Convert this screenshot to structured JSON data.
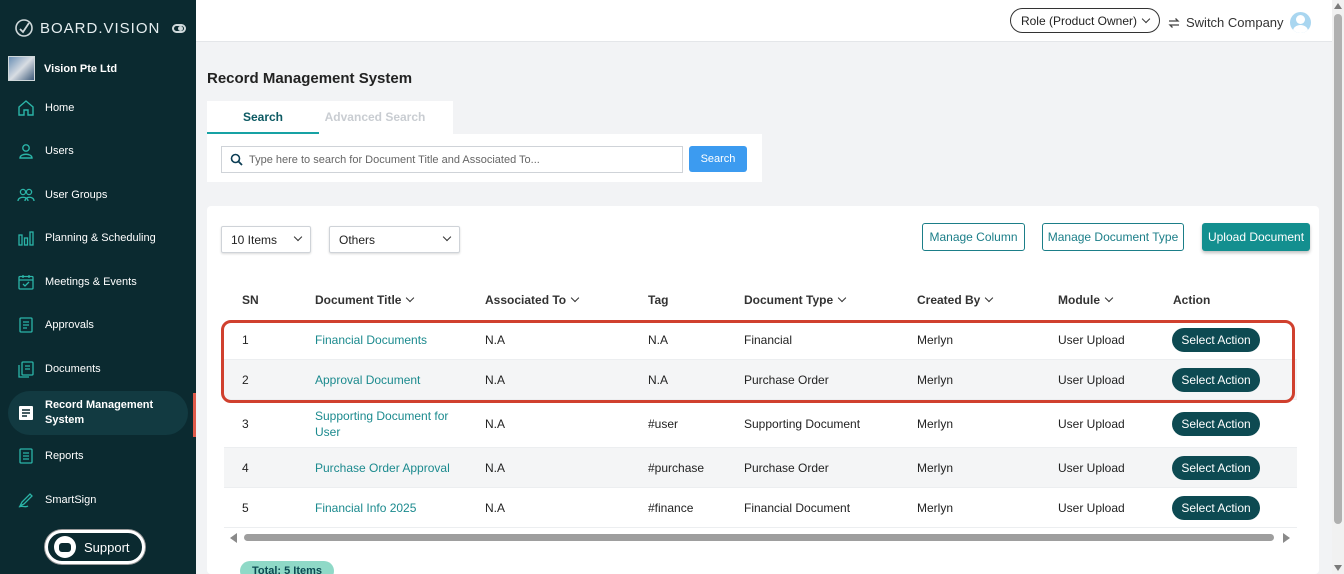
{
  "brand": {
    "name": "BOARD.VISION"
  },
  "company": {
    "name": "Vision Pte Ltd"
  },
  "sidebar": {
    "items": [
      {
        "label": "Home",
        "icon": "home-icon"
      },
      {
        "label": "Users",
        "icon": "user-icon"
      },
      {
        "label": "User Groups",
        "icon": "user-group-icon"
      },
      {
        "label": "Planning & Scheduling",
        "icon": "bar-chart-icon"
      },
      {
        "label": "Meetings & Events",
        "icon": "calendar-icon"
      },
      {
        "label": "Approvals",
        "icon": "approval-icon"
      },
      {
        "label": "Documents",
        "icon": "documents-icon"
      },
      {
        "label": "Record Management System",
        "icon": "record-icon",
        "active": true
      },
      {
        "label": "Reports",
        "icon": "reports-icon"
      },
      {
        "label": "SmartSign",
        "icon": "pen-icon"
      }
    ],
    "support_label": "Support"
  },
  "topbar": {
    "role": "Role (Product Owner)",
    "switch_company": "Switch Company"
  },
  "page": {
    "title": "Record Management System"
  },
  "tabs": [
    {
      "label": "Search",
      "active": true
    },
    {
      "label": "Advanced Search",
      "active": false
    }
  ],
  "search": {
    "placeholder": "Type here to search for Document Title and Associated To...",
    "button": "Search"
  },
  "controls": {
    "items_per_page": "10 Items",
    "filter": "Others",
    "manage_column": "Manage Column",
    "manage_document_type": "Manage Document Type",
    "upload_document": "Upload Document"
  },
  "table": {
    "columns": [
      "SN",
      "Document Title",
      "Associated To",
      "Tag",
      "Document Type",
      "Created By",
      "Module",
      "Action"
    ],
    "rows": [
      {
        "sn": "1",
        "title": "Financial Documents",
        "associated": "N.A",
        "tag": "N.A",
        "type": "Financial",
        "created_by": "Merlyn",
        "module": "User Upload",
        "action": "Select Action"
      },
      {
        "sn": "2",
        "title": "Approval Document",
        "associated": "N.A",
        "tag": "N.A",
        "type": "Purchase Order",
        "created_by": "Merlyn",
        "module": "User Upload",
        "action": "Select Action"
      },
      {
        "sn": "3",
        "title": "Supporting Document for User",
        "associated": "N.A",
        "tag": "#user",
        "type": "Supporting Document",
        "created_by": "Merlyn",
        "module": "User Upload",
        "action": "Select Action"
      },
      {
        "sn": "4",
        "title": "Purchase Order Approval",
        "associated": "N.A",
        "tag": "#purchase",
        "type": "Purchase Order",
        "created_by": "Merlyn",
        "module": "User Upload",
        "action": "Select Action"
      },
      {
        "sn": "5",
        "title": "Financial Info 2025",
        "associated": "N.A",
        "tag": "#finance",
        "type": "Financial Document",
        "created_by": "Merlyn",
        "module": "User Upload",
        "action": "Select Action"
      }
    ],
    "total": "Total: 5 Items"
  },
  "colors": {
    "sidebar_bg": "#0b2a30",
    "accent": "#138f8f",
    "action_btn": "#0d4a52",
    "highlight": "#d0402e"
  }
}
